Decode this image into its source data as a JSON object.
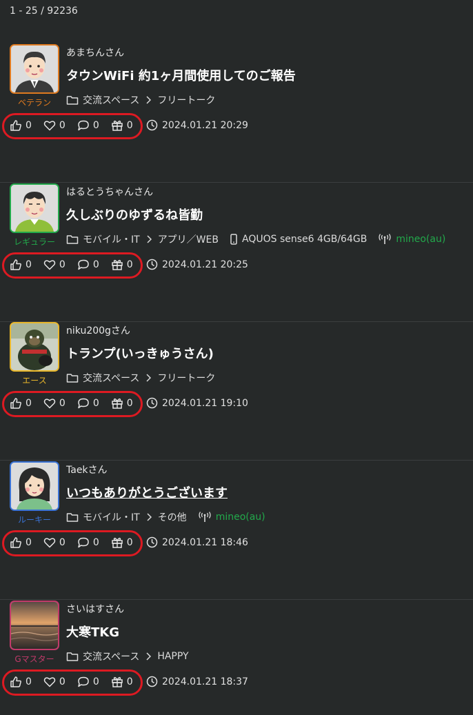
{
  "header": {
    "count_text": "1 - 25 / 92236"
  },
  "posts": [
    {
      "user": "あまちんさん",
      "rank": "ベテラン",
      "rank_color": "#e07a1f",
      "title": "タウンWiFi 約1ヶ月間使用してのご報告",
      "category": "交流スペース",
      "subcategory": "フリートーク",
      "device": "",
      "carrier": "",
      "likes": "0",
      "hearts": "0",
      "comments": "0",
      "gifts": "0",
      "date": "2024.01.21 20:29"
    },
    {
      "user": "はるとうちゃんさん",
      "rank": "レギュラー",
      "rank_color": "#22a94b",
      "title": "久しぶりのゆずるね皆勤",
      "category": "モバイル・IT",
      "subcategory": "アプリ／WEB",
      "device": "AQUOS sense6 4GB/64GB",
      "carrier": "mineo(au)",
      "likes": "0",
      "hearts": "0",
      "comments": "0",
      "gifts": "0",
      "date": "2024.01.21 20:25"
    },
    {
      "user": "niku200gさん",
      "rank": "エース",
      "rank_color": "#e9b72a",
      "title": "トランプ(いっきゅうさん)",
      "category": "交流スペース",
      "subcategory": "フリートーク",
      "device": "",
      "carrier": "",
      "likes": "0",
      "hearts": "0",
      "comments": "0",
      "gifts": "0",
      "date": "2024.01.21 19:10"
    },
    {
      "user": "Taekさん",
      "rank": "ルーキー",
      "rank_color": "#3a73d6",
      "title": "いつもありがとうございます",
      "category": "モバイル・IT",
      "subcategory": "その他",
      "device": "",
      "carrier": "mineo(au)",
      "likes": "0",
      "hearts": "0",
      "comments": "0",
      "gifts": "0",
      "date": "2024.01.21 18:46"
    },
    {
      "user": "さいはすさん",
      "rank": "Gマスター",
      "rank_color": "#c23a6a",
      "title": "大寒TKG",
      "category": "交流スペース",
      "subcategory": "HAPPY",
      "device": "",
      "carrier": "",
      "likes": "0",
      "hearts": "0",
      "comments": "0",
      "gifts": "0",
      "date": "2024.01.21 18:37"
    }
  ]
}
